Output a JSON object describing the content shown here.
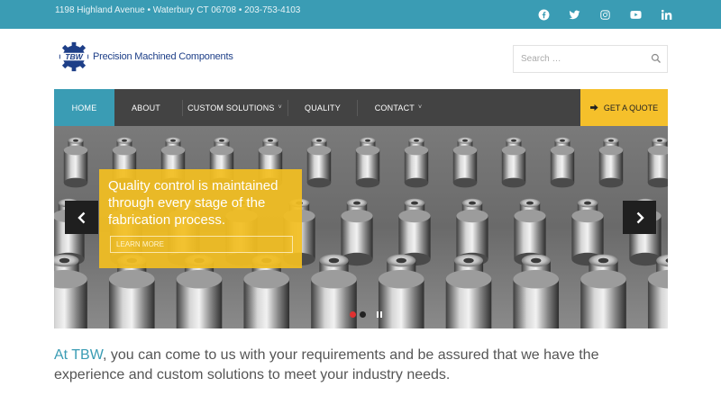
{
  "topbar": {
    "address": "1198 Highland Avenue • Waterbury CT 06708 • 203-753-4103",
    "social_icons": [
      "facebook-icon",
      "twitter-icon",
      "instagram-icon",
      "youtube-icon",
      "linkedin-icon"
    ]
  },
  "header": {
    "logo_mark": "TBW",
    "logo_text": "Precision Machined Components",
    "search": {
      "placeholder": "Search …"
    }
  },
  "nav": {
    "items": [
      {
        "label": "HOME",
        "active": true
      },
      {
        "label": "ABOUT"
      },
      {
        "label": "CUSTOM SOLUTIONS",
        "dropdown": true
      },
      {
        "label": "QUALITY"
      },
      {
        "label": "CONTACT",
        "dropdown": true
      }
    ],
    "dropdown_caret": "˅",
    "quote_label": "GET A QUOTE"
  },
  "slider": {
    "caption": "Quality control is maintained through every stage of the fabrication process.",
    "button_label": "LEARN MORE",
    "slides_count": 2,
    "active_slide": 1
  },
  "intro": {
    "brand": "At TBW",
    "text": ", you can come to us with your requirements and be assured that we have the experience and custom solutions to meet your industry needs."
  },
  "colors": {
    "accent": "#3a9cb4",
    "nav_bg": "#434343",
    "quote_bg": "#f5c02b",
    "caption_bg": "#f2be21",
    "logo_blue": "#1e3f88",
    "dot_active": "#e03030",
    "dot_inactive": "#222222"
  }
}
